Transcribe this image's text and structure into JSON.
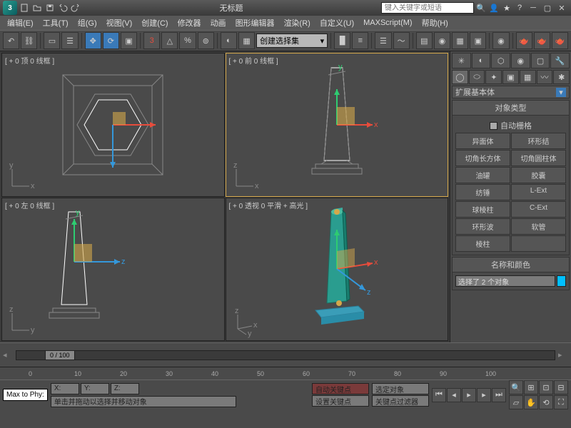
{
  "title": "无标题",
  "search_placeholder": "键入关键字或短语",
  "menu": [
    "编辑(E)",
    "工具(T)",
    "组(G)",
    "视图(V)",
    "创建(C)",
    "修改器",
    "动画",
    "图形编辑器",
    "渲染(R)",
    "自定义(U)",
    "MAXScript(M)",
    "帮助(H)"
  ],
  "selection_set": "创建选择集",
  "viewports": {
    "top": "[ + 0 顶 0 线框 ]",
    "front": "[ + 0 前 0 线框 ]",
    "left": "[ + 0 左 0 线框 ]",
    "persp": "[ + 0 透视 0 平滑 + 高光 ]"
  },
  "panel": {
    "category": "扩展基本体",
    "rollout1": "对象类型",
    "autogrid": "自动栅格",
    "objects": [
      "异面体",
      "环形结",
      "切角长方体",
      "切角圆柱体",
      "油罐",
      "胶囊",
      "纺锤",
      "L-Ext",
      "球棱柱",
      "C-Ext",
      "环形波",
      "软管",
      "棱柱",
      ""
    ],
    "rollout2": "名称和颜色",
    "name_value": "选择了 2 个对象"
  },
  "timeline": {
    "pos": "0 / 100",
    "ticks": [
      "0",
      "10",
      "20",
      "30",
      "40",
      "50",
      "60",
      "70",
      "80",
      "90",
      "100"
    ]
  },
  "status": {
    "maxphy": "Max to Phy:",
    "hint": "单击并拖动以选择并移动对象",
    "autokey": "自动关键点",
    "selobj": "选定对象",
    "setkey": "设置关键点",
    "filter": "关键点过滤器"
  }
}
